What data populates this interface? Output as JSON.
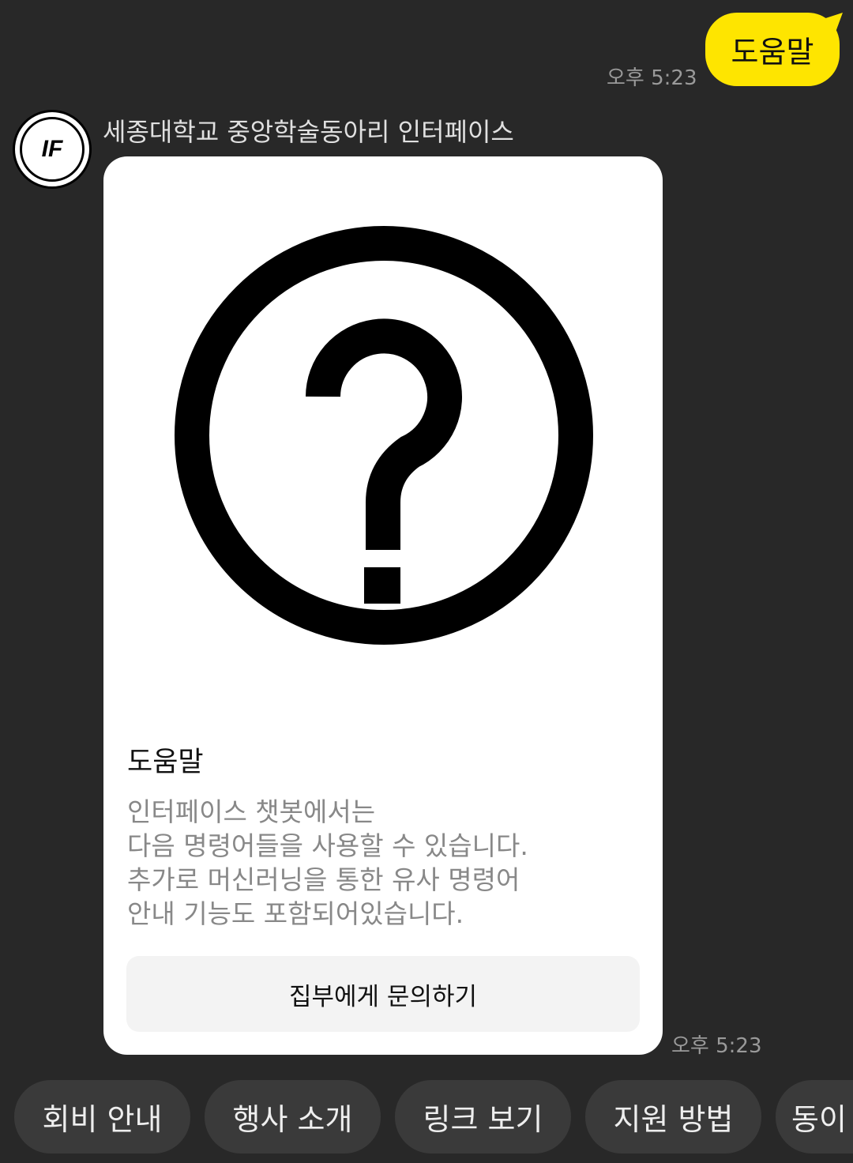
{
  "user_message": {
    "text": "도움말",
    "time": "오후 5:23"
  },
  "bot": {
    "sender": "세종대학교 중앙학술동아리 인터페이스",
    "avatar_logo": "InterFace",
    "time": "오후 5:23"
  },
  "card": {
    "icon": "question-circle-icon",
    "title": "도움말",
    "description": "인터페이스 챗봇에서는\n다음 명령어들을 사용할 수 있습니다.\n추가로 머신러닝을 통한 유사 명령어\n안내 기능도 포함되어있습니다.",
    "button": "집부에게 문의하기"
  },
  "quick_replies": [
    "회비 안내",
    "행사 소개",
    "링크 보기",
    "지원 방법",
    "동이"
  ]
}
